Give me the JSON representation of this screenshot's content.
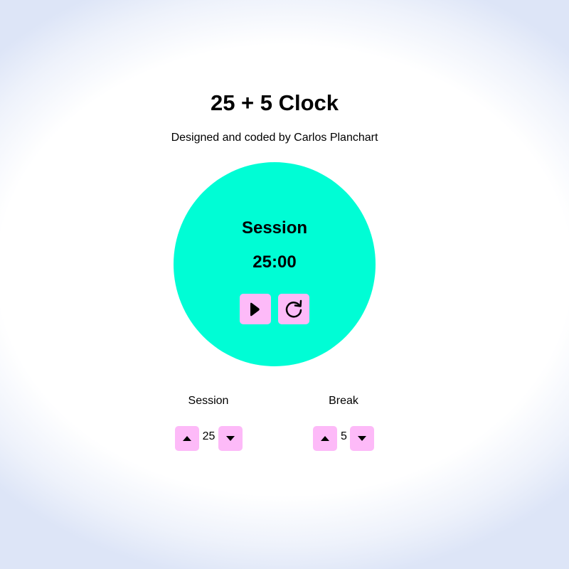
{
  "header": {
    "title": "25 + 5 Clock",
    "subtitle": "Designed and coded by Carlos Planchart"
  },
  "timer": {
    "label": "Session",
    "time": "25:00",
    "play_icon": "play-icon",
    "reset_icon": "reset-icon"
  },
  "session": {
    "label": "Session",
    "value": "25"
  },
  "break": {
    "label": "Break",
    "value": "5"
  },
  "colors": {
    "circle": "#00fdd5",
    "button": "#fdbaf8"
  }
}
